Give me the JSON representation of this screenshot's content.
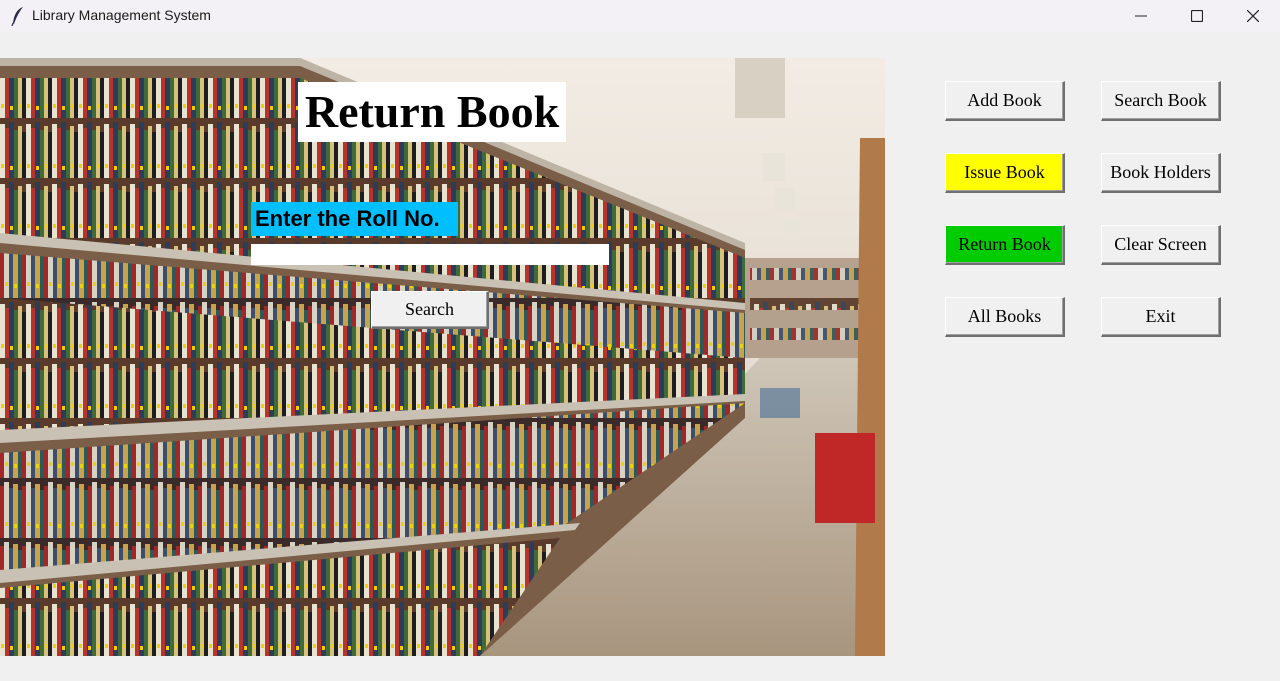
{
  "window": {
    "title": "Library Management System"
  },
  "main": {
    "heading": "Return Book",
    "roll_label": "Enter the Roll No.",
    "roll_value": "",
    "search_label": "Search"
  },
  "sidebar": {
    "buttons": [
      {
        "label": "Add Book",
        "color": "#f0f0f0"
      },
      {
        "label": "Search Book",
        "color": "#f0f0f0"
      },
      {
        "label": "Issue Book",
        "color": "#ffff00"
      },
      {
        "label": "Book Holders",
        "color": "#f0f0f0"
      },
      {
        "label": "Return Book",
        "color": "#00cc00"
      },
      {
        "label": "Clear Screen",
        "color": "#f0f0f0"
      },
      {
        "label": "All Books",
        "color": "#f0f0f0"
      },
      {
        "label": "Exit",
        "color": "#f0f0f0"
      }
    ]
  },
  "colors": {
    "label_bg": "#00bfff",
    "window_bg": "#f0f0f0"
  }
}
